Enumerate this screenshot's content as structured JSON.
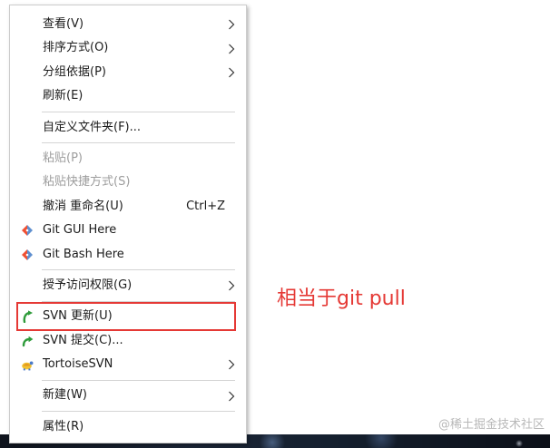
{
  "menu": {
    "items": [
      {
        "label": "查看(V)",
        "submenu": true
      },
      {
        "label": "排序方式(O)",
        "submenu": true
      },
      {
        "label": "分组依据(P)",
        "submenu": true
      },
      {
        "label": "刷新(E)"
      },
      {
        "label": "自定义文件夹(F)..."
      },
      {
        "label": "粘贴(P)",
        "disabled": true
      },
      {
        "label": "粘贴快捷方式(S)",
        "disabled": true
      },
      {
        "label": "撤消 重命名(U)",
        "shortcut": "Ctrl+Z"
      },
      {
        "label": "Git GUI Here",
        "icon": "git-icon"
      },
      {
        "label": "Git Bash Here",
        "icon": "git-icon"
      },
      {
        "label": "授予访问权限(G)",
        "submenu": true
      },
      {
        "label": "SVN 更新(U)",
        "icon": "svn-update-icon",
        "highlighted": true
      },
      {
        "label": "SVN 提交(C)...",
        "icon": "svn-commit-icon"
      },
      {
        "label": "TortoiseSVN",
        "icon": "tortoisesvn-icon",
        "submenu": true
      },
      {
        "label": "新建(W)",
        "submenu": true
      },
      {
        "label": "属性(R)"
      }
    ]
  },
  "annotation": {
    "text": "相当于git pull"
  },
  "watermark": "@稀土掘金技术社区",
  "colors": {
    "annotation_red": "#e53935",
    "disabled_text": "#9d9d9d"
  }
}
